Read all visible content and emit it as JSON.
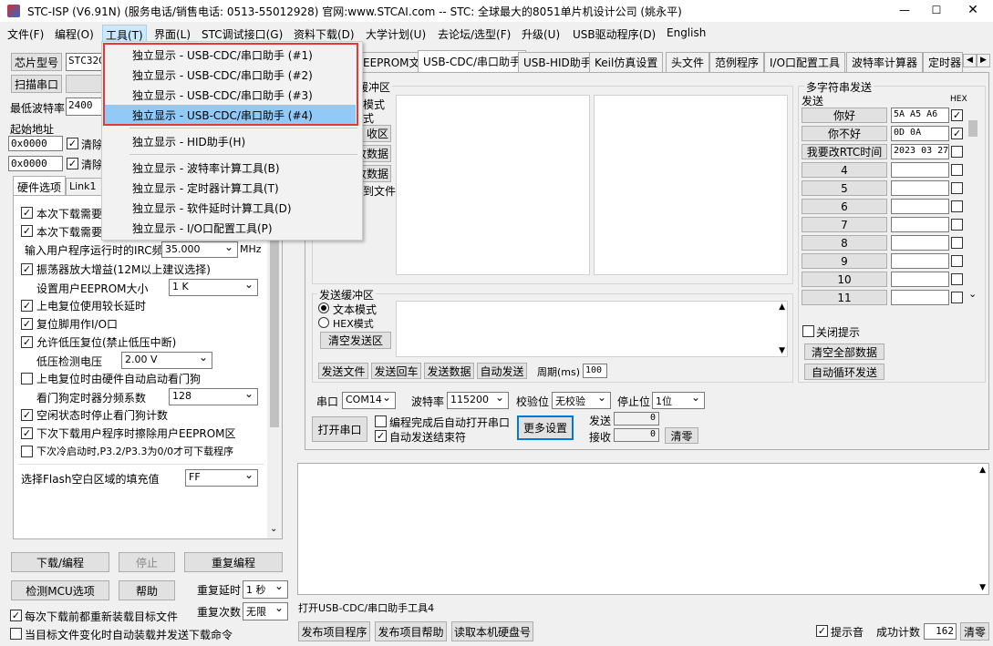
{
  "title": {
    "app": "STC-ISP (V6.91N) (服务电话/销售电话: 0513-55012928) 官网:www.STCAI.com  -- STC: 全球最大的8051单片机设计公司 (姚永平)"
  },
  "menubar": [
    "文件(F)",
    "编程(O)",
    "工具(T)",
    "界面(L)",
    "STC调试接口(G)",
    "资料下载(D)",
    "大学计划(U)",
    "去论坛/选型(F)",
    "升级(U)",
    "USB驱动程序(D)",
    "English"
  ],
  "dropdown": {
    "items": [
      "独立显示 - USB-CDC/串口助手 (#1)",
      "独立显示 - USB-CDC/串口助手 (#2)",
      "独立显示 - USB-CDC/串口助手 (#3)",
      "独立显示 - USB-CDC/串口助手 (#4)",
      "独立显示 - HID助手(H)",
      "独立显示 - 波特率计算工具(B)",
      "独立显示 - 定时器计算工具(T)",
      "独立显示 - 软件延时计算工具(D)",
      "独立显示 - I/O口配置工具(P)"
    ]
  },
  "left": {
    "chip_btn": "芯片型号",
    "chip_value": "STC32G",
    "scan_btn": "扫描串口",
    "baud_label": "最低波特率",
    "baud_value": "2400",
    "start_addr": "起始地址",
    "addr1": "0x0000",
    "addr2": "0x0000",
    "clear1": "清除",
    "clear2": "清除",
    "hw_tab": "硬件选项",
    "link_tab": "Link1",
    "opts": {
      "o1": "本次下载需要",
      "o2": "本次下载需要",
      "irc_label": "输入用户程序运行时的IRC频率",
      "irc_value": "35.000",
      "irc_unit": "MHz",
      "osc": "振荡器放大增益(12M以上建议选择)",
      "eeprom_label": "设置用户EEPROM大小",
      "eeprom_value": "1   K",
      "delay": "上电复位使用较长延时",
      "reset_io": "复位脚用作I/O口",
      "lvr": "允许低压复位(禁止低压中断)",
      "lv_label": "低压检测电压",
      "lv_value": "2.00 V",
      "wdt": "上电复位时由硬件自动启动看门狗",
      "wdt_div_label": "看门狗定时器分频系数",
      "wdt_div_value": "128",
      "idle_wdt": "空闲状态时停止看门狗计数",
      "erase": "下次下载用户程序时擦除用户EEPROM区",
      "cold": "下次冷启动时,P3.2/P3.3为0/0才可下载程序",
      "flash_label": "选择Flash空白区域的填充值",
      "flash_value": "FF"
    },
    "btn_download": "下载/编程",
    "btn_stop": "停止",
    "btn_reprogram": "重复编程",
    "btn_check": "检测MCU选项",
    "btn_help": "帮助",
    "repeat_delay_label": "重复延时",
    "repeat_delay_value": "1 秒",
    "repeat_count_label": "重复次数",
    "repeat_count_value": "无限",
    "reload": "每次下载前都重新装载目标文件",
    "auto_reload": "当目标文件变化时自动装载并发送下载命令"
  },
  "tabs": [
    "EEPROM文件",
    "USB-CDC/串口助手",
    "USB-HID助手",
    "Keil仿真设置",
    "头文件",
    "范例程序",
    "I/O口配置工具",
    "波特率计算器",
    "定时器"
  ],
  "serial": {
    "recv_title": "缓冲区",
    "recv_mode1": "模式",
    "recv_mode2": "式",
    "recv_btn1": "收区",
    "recv_btn2": "收数据",
    "recv_btn3": "收数据",
    "recv_file": "到文件",
    "send_title": "发送缓冲区",
    "text_mode": "文本模式",
    "hex_mode": "HEX模式",
    "clear_send": "清空发送区",
    "send_file": "发送文件",
    "send_back": "发送回车",
    "send_data": "发送数据",
    "auto_send": "自动发送",
    "period_label": "周期(ms)",
    "period_value": "100",
    "port_label": "串口",
    "port_value": "COM14",
    "baud_label": "波特率",
    "baud_value": "115200",
    "parity_label": "校验位",
    "parity_value": "无校验",
    "stop_label": "停止位",
    "stop_value": "1位",
    "open_btn": "打开串口",
    "auto_open": "编程完成后自动打开串口",
    "auto_end": "自动发送结束符",
    "more_btn": "更多设置",
    "tx_label": "发送",
    "tx_value": "0",
    "rx_label": "接收",
    "rx_value": "0",
    "clear_btn": "清零"
  },
  "multi": {
    "title": "多字符串发送",
    "send_col": "发送",
    "hex_col": "HEX",
    "rows": [
      {
        "label": "你好",
        "value": "5A A5 A6",
        "hex": true
      },
      {
        "label": "你不好",
        "value": "0D 0A",
        "hex": true
      },
      {
        "label": "我要改RTC时间",
        "value": "2023 03 27",
        "hex": false
      },
      {
        "label": "4",
        "value": "",
        "hex": false
      },
      {
        "label": "5",
        "value": "",
        "hex": false
      },
      {
        "label": "6",
        "value": "",
        "hex": false
      },
      {
        "label": "7",
        "value": "",
        "hex": false
      },
      {
        "label": "8",
        "value": "",
        "hex": false
      },
      {
        "label": "9",
        "value": "",
        "hex": false
      },
      {
        "label": "10",
        "value": "",
        "hex": false
      },
      {
        "label": "11",
        "value": "",
        "hex": false
      }
    ],
    "close_tip": "关闭提示",
    "clear_all": "清空全部数据",
    "auto_loop": "自动循环发送"
  },
  "status": {
    "text": "打开USB-CDC/串口助手工具4",
    "publish_prog": "发布项目程序",
    "publish_help": "发布项目帮助",
    "read_disk": "读取本机硬盘号",
    "tip_sound": "提示音",
    "success_label": "成功计数",
    "success_value": "162",
    "clear": "清零"
  }
}
